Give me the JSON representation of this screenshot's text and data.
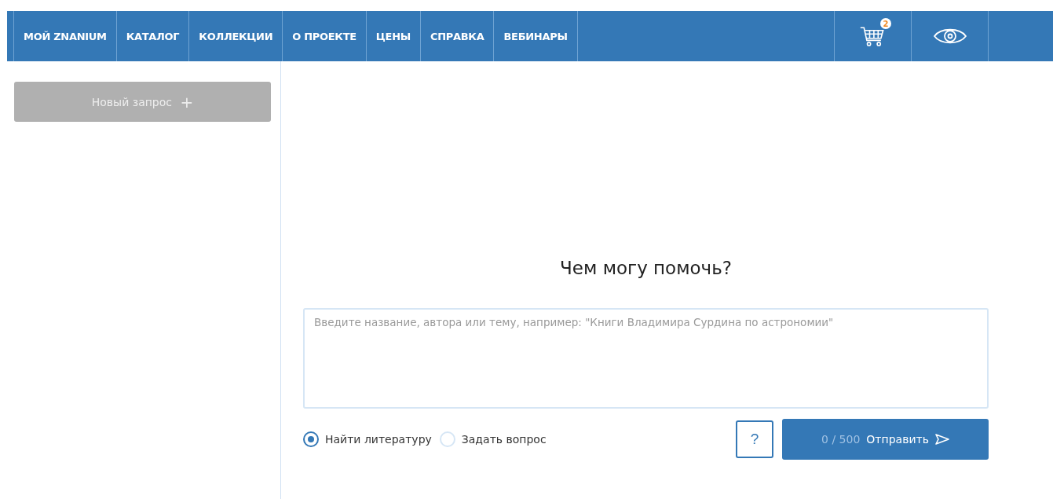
{
  "nav": {
    "items": [
      {
        "label": "МОЙ ZNANIUM"
      },
      {
        "label": "КАТАЛОГ"
      },
      {
        "label": "КОЛЛЕКЦИИ"
      },
      {
        "label": "О ПРОЕКТЕ"
      },
      {
        "label": "ЦЕНЫ"
      },
      {
        "label": "СПРАВКА"
      },
      {
        "label": "ВЕБИНАРЫ"
      }
    ],
    "cart_count": "2"
  },
  "sidebar": {
    "new_request_button": "Новый запрос",
    "new_request_icon": "+"
  },
  "main": {
    "heading": "Чем могу помочь?",
    "query": {
      "placeholder": "Введите название, автора или тему, например: \"Книги Владимира Сурдина по астрономии\""
    },
    "modes": [
      {
        "label": "Найти литературу",
        "selected": true
      },
      {
        "label": "Задать вопрос",
        "selected": false
      }
    ],
    "help_button": "?",
    "counter": "0 / 500",
    "send_button": "Отправить"
  }
}
